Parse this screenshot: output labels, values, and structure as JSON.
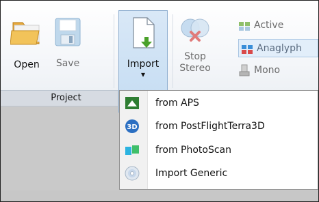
{
  "ribbon": {
    "open_label": "Open",
    "save_label": "Save",
    "import_label": "Import",
    "import_arrow": "▾",
    "stop_stereo_line1": "Stop",
    "stop_stereo_line2": "Stereo",
    "active_label": "Active",
    "anaglyph_label": "Anaglyph",
    "mono_label": "Mono",
    "group_label": "Project"
  },
  "import_menu": {
    "items": [
      {
        "label": "from APS",
        "icon": "aps-icon"
      },
      {
        "label": "from PostFlightTerra3D",
        "icon": "3d-icon"
      },
      {
        "label": "from PhotoScan",
        "icon": "photoscan-icon"
      },
      {
        "label": "Import Generic",
        "icon": "disc-icon"
      }
    ]
  },
  "colors": {
    "import_highlight": "#c4dcf2",
    "ribbon_bg": "#f4f6f9",
    "menu_bg": "#ffffff"
  }
}
